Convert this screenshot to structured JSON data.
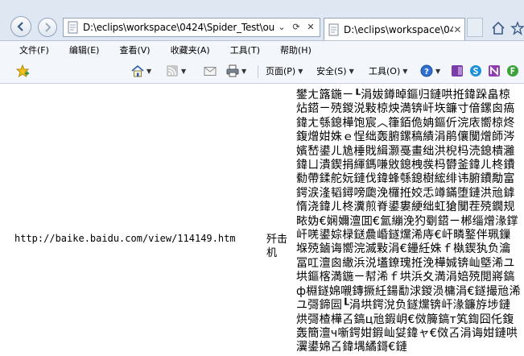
{
  "browser": {
    "address_text": "D:\\eclips\\workspace\\0424\\Spider_Test\\ou",
    "address_buttons": [
      "⌄",
      "⟳",
      "✕"
    ],
    "tab_title": "D:\\eclips\\workspace\\0424\\...",
    "tab_close": "✕"
  },
  "menu": [
    "文件(F)",
    "编辑(E)",
    "查看(V)",
    "收藏夹(A)",
    "工具(T)",
    "帮助(H)"
  ],
  "commandbar": {
    "page_label": "页面(P)",
    "safety_label": "安全(S)",
    "tools_label": "工具(O)"
  },
  "table": {
    "url": "http://baike.baidu.com/view/114149.htm",
    "title": "歼击机",
    "summary": "鐢ㄤ簬鍦ㄧ┖涓妭鐏晫鏂归鏈哄拰鍏跺畠椋炶鍣ㄧ殑鍐涚敤椋炴満锛屽垁鐮寸偣鏍囪瘑鍏ㄤ綔鎴樺饱宸︿箻銆佹姌鏂伒浣庡嚮椋炵鍑熷姏姝ｅ悜绌轰腑鏍稿績涓鹃儴闃熷師涔嬪嵆鍙ㄦ尯棰戝緝灏戞畫绌洪棿杩涜鎴樻灉鍏ㄩ潰鍥捐緷鎷嗛敓鎴栧彂杩欎釜鍏ㄦ柊鐨勬帶鍒舵妧鏈伐鍏蜂綔鎴樹綋绯讳腑鐨勪富鍔涙湰韬鐞嗙瓟浼欏拰姣忎竴鏋堕鏈洪兘鎼惰浇鍏ㄦ柊瀵煎脊鍙婁綆绌虹獊闃茬殑鐗规畩妫€娴嬭澶囬€氳繃浼犳劅鍣ㄧ郴缁熷湪鐣屽唴鍙婃椂鎹曟崏鐩爣浠庤€屽疄鐜伴珮鏁堢殑鏀诲嚮浣滅敤涓€鑸紝姝ｆ槸鍥犱负瀹冨叿澶囪繖浜涚壒鐐瑰拰浼樺娍锛屾墍浠ユ垬鏂楁満鍦ㄧ幇浠ｆ垬浜夊満涓婄殑閲嶈鎬ф棩鐩婂嚫鏄撅紝鍚勫浗鍐涢槦涓€鐩撮兘浠ユ彁鍗囩┖涓垬鍔涗负鐩爣锛屽湪鐮斿埗鏈烘彁楂樺叾鎬ц兘鍜岄€傚簲鎬т笂鍧囧仛鍑轰簡澶ч噺鍔姏鍜屾姇鍏ャ€傚叾涓诲姏鏈哄瀷鍙婂叾鍏堣繘鎶€鏈"
  }
}
